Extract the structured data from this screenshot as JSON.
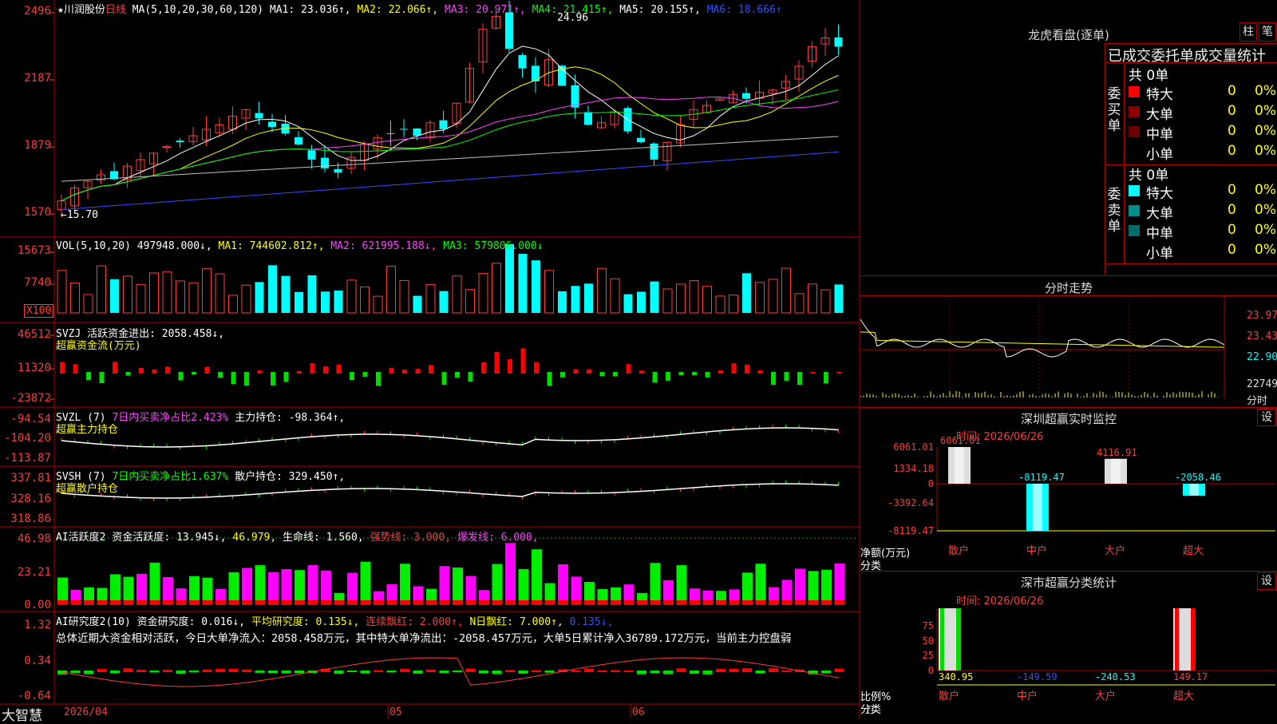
{
  "header": {
    "star": "★",
    "stock": "川润股份",
    "period": "日线",
    "ma_params": "MA(5,10,20,30,60,120)",
    "ma1": "MA1: 23.036↑,",
    "ma2": "MA2: 22.066↑,",
    "ma3": "MA3: 20.971↑,",
    "ma4": "MA4: 21.415↑,",
    "ma5": "MA5: 20.155↑,",
    "ma6": "MA6: 18.666↑"
  },
  "main_axis": [
    "2496",
    "2187",
    "1879",
    "1570"
  ],
  "price_markers": {
    "high": "24.96",
    "low": "←15.70"
  },
  "vol": {
    "label": "VOL(5,10,20)",
    "value": "497948.000↓,",
    "ma1": "MA1: 744602.812↑,",
    "ma2": "MA2: 621995.188↓,",
    "ma3": "MA3: 579806.000↓",
    "axis": [
      "15673",
      "7740"
    ],
    "unit": "X100"
  },
  "svzj": {
    "label": "SVZJ  活跃资金进出: 2058.458↓,",
    "sub": "超赢资金流(万元)",
    "axis": [
      "46512",
      "11320",
      "-23872"
    ]
  },
  "svzl": {
    "label": "SVZL (7)",
    "pct": "7日内买卖净占比2.423%",
    "hold": "主力持仓: -98.364↑,",
    "sub": "超赢主力持仓",
    "axis": [
      "-94.54",
      "-104.20",
      "-113.87"
    ]
  },
  "svsh": {
    "label": "SVSH (7)",
    "pct": "7日内买卖净占比1.637%",
    "hold": "散户持仓: 329.450↑,",
    "sub": "超赢散户持仓",
    "axis": [
      "337.81",
      "328.16",
      "318.86"
    ]
  },
  "ai1": {
    "label": "AI活跃度2",
    "v1": "资金活跃度: 13.945↓,",
    "v2": "46.979,",
    "v3": "生命线: 1.560,",
    "v4": "强势线: 3.000,",
    "v5": "爆发线: 6.000,",
    "axis": [
      "46.98",
      "23.21",
      "0.00"
    ]
  },
  "ai2": {
    "label": "AI研究度2(10)",
    "v1": "资金研究度: 0.016↓,",
    "v2": "平均研究度: 0.135↓,",
    "v3": "连续飘红: 2.000↑,",
    "v4": "N日飘红: 7.000↑,",
    "v5": "0.135↓,",
    "summary": "总体近期大资金相对活跃，今日大单净流入：2058.458万元，其中特大单净流出：-2058.457万元，大单5日累计净入36789.172万元，当前主力控盘弱",
    "axis": [
      "1.32",
      "0.34",
      "-0.64"
    ]
  },
  "footer": {
    "brand": "大智慧",
    "d1": "2026/04",
    "d2": "05",
    "d3": "06"
  },
  "lhb": {
    "title": "龙虎看盘(逐单)",
    "btn1": "柱",
    "btn2": "笔",
    "tab": "已成交委托单成交量统计",
    "buy_side": "委买单",
    "sell_side": "委卖单",
    "buy_total": "共 0单",
    "sell_total": "共 0单",
    "rows": [
      {
        "name": "特大",
        "v": "0",
        "p": "0%"
      },
      {
        "name": "大单",
        "v": "0",
        "p": "0%"
      },
      {
        "name": "中单",
        "v": "0",
        "p": "0%"
      },
      {
        "name": "小单",
        "v": "0",
        "p": "0%"
      }
    ],
    "buy_colors": [
      "#ff0000",
      "#8b0000",
      "#6b0000"
    ],
    "sell_colors": [
      "#00ffff",
      "#008b8b",
      "#006b6b"
    ]
  },
  "intraday": {
    "title": "分时走势",
    "p1": "23.97",
    "p2": "23.43",
    "p3": "22.90",
    "vol": "22749",
    "vol_unit": "分时"
  },
  "monitor": {
    "title": "深圳超赢实时监控",
    "btn": "设",
    "time": "时间: 2026/06/26",
    "axis": [
      "6061.01",
      "1334.18",
      "0",
      "-3392.64",
      "-8119.47"
    ],
    "ylabel": "净额(万元)",
    "xlabel": "分类",
    "cats": [
      "散户",
      "中户",
      "大户",
      "超大"
    ]
  },
  "classify": {
    "title": "深市超赢分类统计",
    "btn": "设",
    "time": "时间: 2026/06/26",
    "axis": [
      "75",
      "50",
      "25",
      "0"
    ],
    "ylabel": "比例%",
    "xlabel": "分类",
    "cats": [
      "散户",
      "中户",
      "大户",
      "超大"
    ]
  },
  "chart_data": [
    {
      "type": "bar",
      "title": "深圳超赢实时监控",
      "ylabel": "净额(万元)",
      "xlabel": "分类",
      "categories": [
        "散户",
        "中户",
        "大户",
        "超大"
      ],
      "values": [
        6061.01,
        -8119.47,
        4116.91,
        -2058.46
      ],
      "labels": [
        "6061.01",
        "-8119.47",
        "4116.91",
        "-2058.46"
      ],
      "ylim": [
        -8119.47,
        6061.01
      ]
    },
    {
      "type": "bar",
      "title": "深市超赢分类统计",
      "ylabel": "比例%",
      "xlabel": "分类",
      "categories": [
        "散户",
        "中户",
        "大户",
        "超大"
      ],
      "values": [
        340.95,
        -149.59,
        -240.53,
        149.17
      ],
      "labels": [
        "340.95",
        "-149.59",
        "-240.53",
        "149.17"
      ]
    }
  ]
}
